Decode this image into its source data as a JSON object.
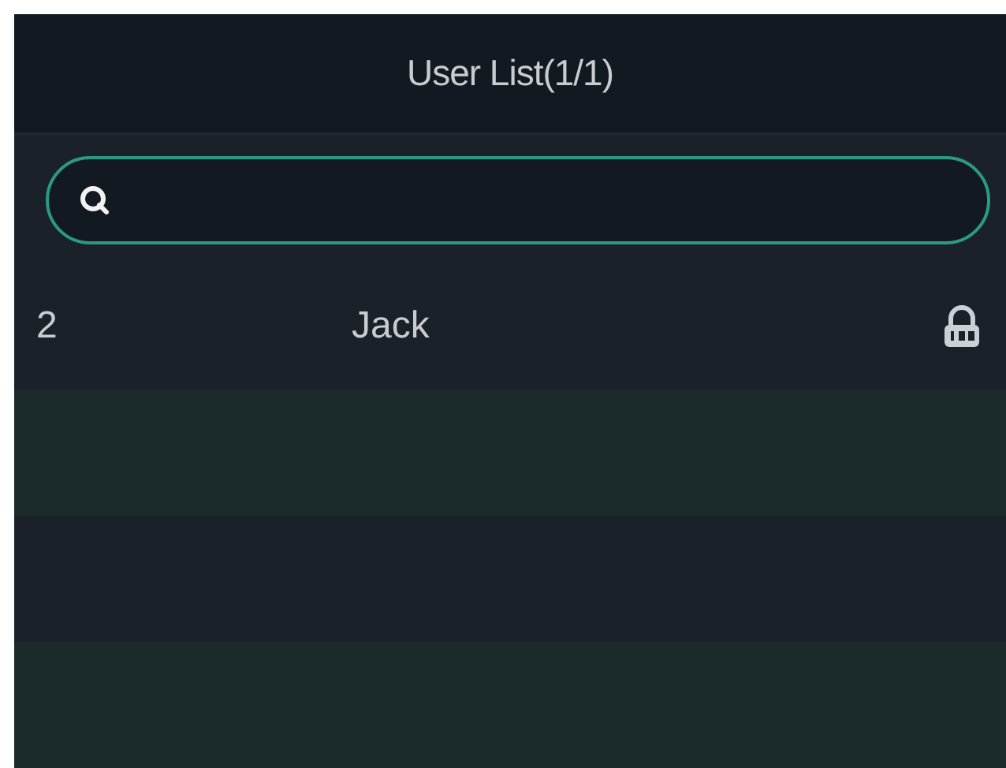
{
  "header": {
    "title": "User List(1/1)"
  },
  "search": {
    "kind": "search"
  },
  "users": [
    {
      "number": "2",
      "name": "Jack",
      "kind": "password"
    }
  ]
}
